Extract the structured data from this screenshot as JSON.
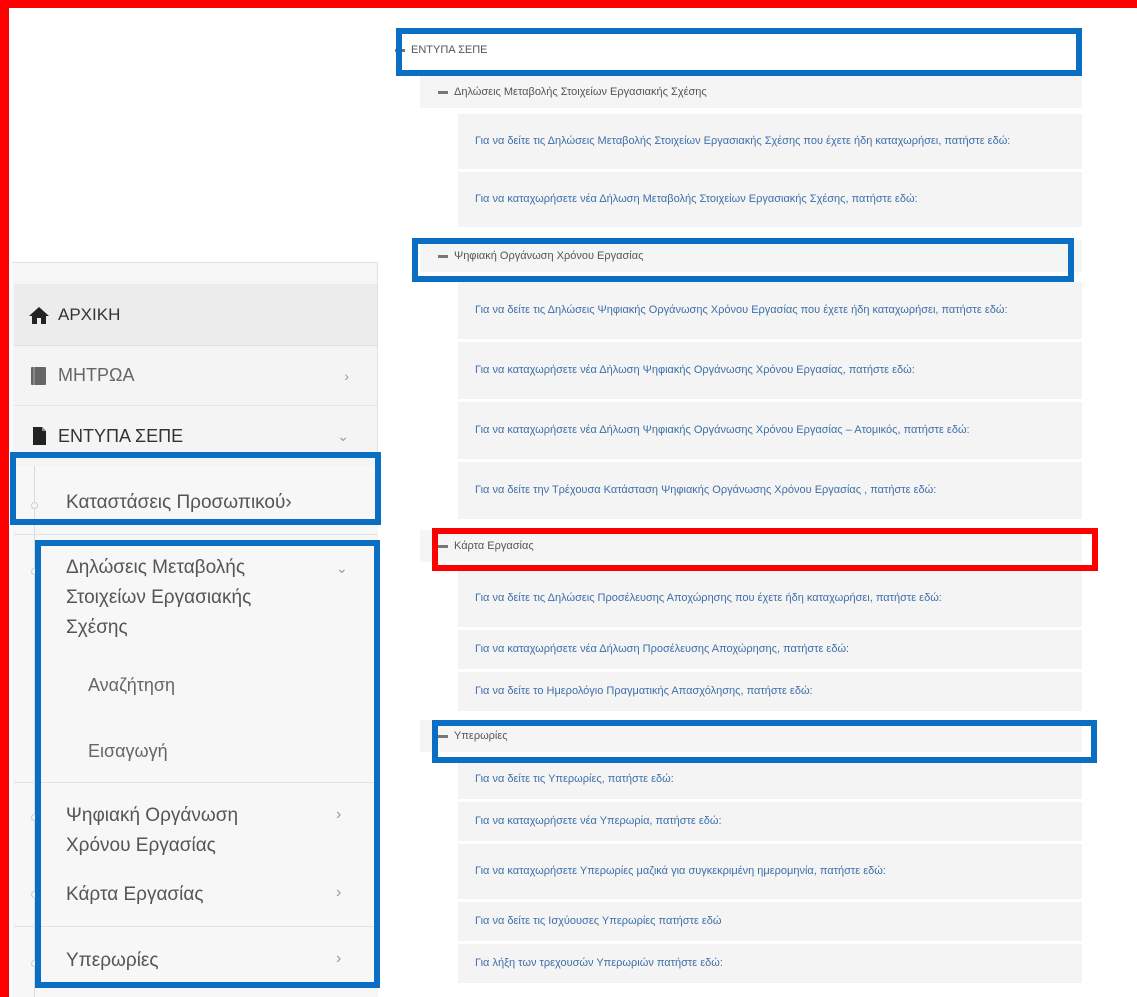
{
  "sidebar": {
    "home": {
      "label": "ΑΡΧΙΚΗ",
      "icon": "home-icon"
    },
    "mitroa": {
      "label": "ΜΗΤΡΩΑ",
      "icon": "book-icon",
      "chevron": "›"
    },
    "entypa": {
      "label": "ΕΝΤΥΠΑ ΣΕΠΕ",
      "icon": "document-icon",
      "chevron": "⌄"
    },
    "sub": {
      "katastaseis": "Καταστάσεις Προσωπικού›",
      "dilwseis_line1": "Δηλώσεις Μεταβολής",
      "dilwseis_line2": "Στοιχείων Εργασιακής",
      "dilwseis_line3": "Σχέσης",
      "dilwseis_chevron": "⌄",
      "anazitisi": "Αναζήτηση",
      "eisagogi": "Εισαγωγή",
      "psifiaki_line1": "Ψηφιακή Οργάνωση",
      "psifiaki_line2": "Χρόνου Εργασίας",
      "karta": "Κάρτα Εργασίας",
      "yperories": "Υπερωρίες",
      "chevron": "›"
    }
  },
  "panel": {
    "root": "ΕΝΤΥΠΑ ΣΕΠΕ",
    "sections": [
      {
        "title": "Δηλώσεις Μεταβολής Στοιχείων Εργασιακής Σχέσης",
        "links": [
          "Για να δείτε τις Δηλώσεις Μεταβολής Στοιχείων Εργασιακής Σχέσης που έχετε ήδη καταχωρήσει, πατήστε εδώ:",
          "Για να καταχωρήσετε νέα Δήλωση Μεταβολής Στοιχείων Εργασιακής Σχέσης, πατήστε εδώ:"
        ]
      },
      {
        "title": "Ψηφιακή Οργάνωση Χρόνου Εργασίας",
        "links": [
          "Για να δείτε τις Δηλώσεις Ψηφιακής Οργάνωσης Χρόνου Εργασίας που έχετε ήδη καταχωρήσει, πατήστε εδώ:",
          "Για να καταχωρήσετε νέα Δήλωση Ψηφιακής Οργάνωσης Χρόνου Εργασίας, πατήστε εδώ:",
          "Για να καταχωρήσετε νέα Δήλωση Ψηφιακής Οργάνωσης Χρόνου Εργασίας – Ατομικός, πατήστε εδώ:",
          "Για να δείτε την Τρέχουσα Κατάσταση Ψηφιακής Οργάνωσης Χρόνου Εργασίας , πατήστε εδώ:"
        ]
      },
      {
        "title": "Κάρτα Εργασίας",
        "links": [
          "Για να δείτε τις Δηλώσεις Προσέλευσης Αποχώρησης που έχετε ήδη καταχωρήσει, πατήστε εδώ:",
          "Για να καταχωρήσετε νέα Δήλωση Προσέλευσης Αποχώρησης, πατήστε εδώ:",
          "Για να δείτε το Ημερολόγιο Πραγματικής Απασχόλησης, πατήστε εδώ:"
        ]
      },
      {
        "title": "Υπερωρίες",
        "links": [
          "Για να δείτε τις Υπερωρίες, πατήστε εδώ:",
          "Για να καταχωρήσετε νέα Υπερωρία, πατήστε εδώ:",
          "Για να καταχωρήσετε Υπερωρίες μαζικά για συγκεκριμένη ημερομηνία, πατήστε εδώ:",
          "Για να δείτε τις Ισχύουσες Υπερωρίες πατήστε εδώ",
          "Για λήξη των τρεχουσών Υπερωριών πατήστε εδώ:"
        ]
      }
    ]
  },
  "colors": {
    "annotation_blue": "#0a6fc2",
    "annotation_red": "#ff0000",
    "link": "#3d6fa8"
  }
}
